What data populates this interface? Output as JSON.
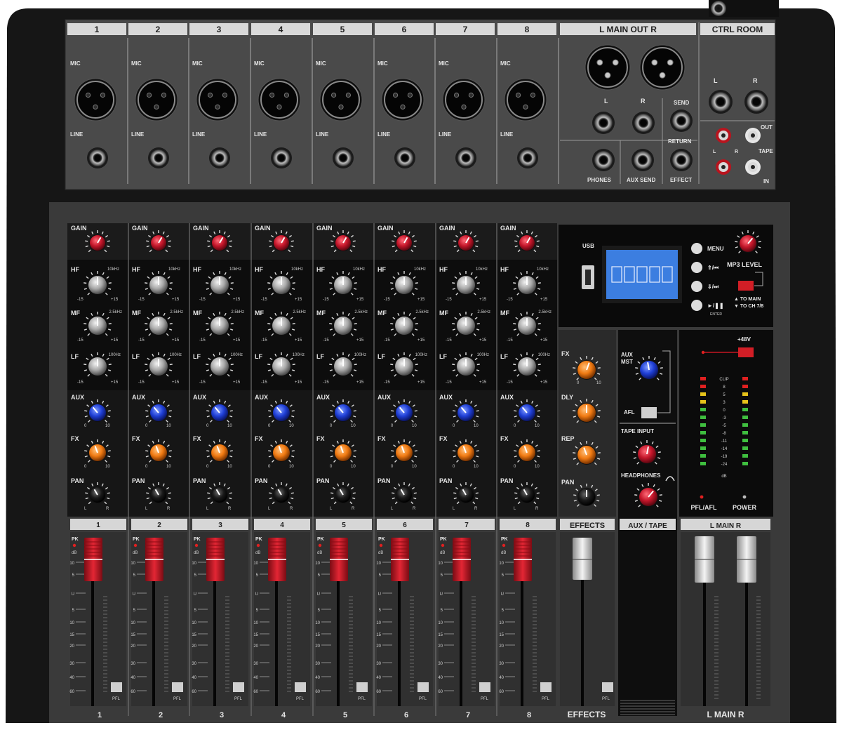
{
  "top_panel": {
    "channel_numbers": [
      "1",
      "2",
      "3",
      "4",
      "5",
      "6",
      "7",
      "8"
    ],
    "main_out_title": "L  MAIN OUT  R",
    "ctrl_room_title": "CTRL ROOM",
    "mic_label": "MIC",
    "line_label": "LINE",
    "main_out_l": "L",
    "main_out_r": "R",
    "send_label": "SEND",
    "return_label": "RETURN",
    "phones_label": "PHONES",
    "aux_send_label": "AUX SEND",
    "effect_label": "EFFECT",
    "ctrl_l": "L",
    "ctrl_r": "R",
    "out_label": "OUT",
    "tape_label": "TAPE",
    "in_label": "IN",
    "tape_l": "L",
    "tape_r": "R"
  },
  "channel_strip": {
    "gain_label": "GAIN",
    "hf_label": "HF",
    "hf_freq": "10kHz",
    "mf_label": "MF",
    "mf_freq": "2.5kHz",
    "lf_label": "LF",
    "lf_freq": "100Hz",
    "eq_min": "-15",
    "eq_max": "+15",
    "aux_label": "AUX",
    "fx_label": "FX",
    "pan_label": "PAN",
    "send_min": "0",
    "send_max": "10",
    "pan_left": "L",
    "pan_right": "R",
    "pk_label": "PK",
    "db_label": "dB",
    "u_label": "U",
    "pfl_label": "PFL",
    "fader_scale": [
      "10",
      "5",
      "U",
      "5",
      "10",
      "15",
      "20",
      "30",
      "40",
      "60"
    ]
  },
  "channels": [
    {
      "number": "1"
    },
    {
      "number": "2"
    },
    {
      "number": "3"
    },
    {
      "number": "4"
    },
    {
      "number": "5"
    },
    {
      "number": "6"
    },
    {
      "number": "7"
    },
    {
      "number": "8"
    }
  ],
  "mp3_player": {
    "usb_label": "USB",
    "menu_label": "MENU",
    "prev_label": "⇑/⏮",
    "next_label": "⇓/⏭",
    "play_label": "►/❚❚",
    "enter_label": "ENTER",
    "mp3_level_label": "MP3 LEVEL",
    "to_main_label": "▲ TO MAIN",
    "to_ch_label": "▼ TO CH 7/8",
    "screen_bg": "#3c7ee0"
  },
  "effects_section": {
    "fx_label": "FX",
    "dly_label": "DLY",
    "rep_label": "REP",
    "pan_label": "PAN",
    "section_title": "EFFECTS",
    "bottom_label": "EFFECTS",
    "pfl_label": "PFL",
    "min": "0",
    "max": "10"
  },
  "aux_tape_section": {
    "aux_mst_label": "AUX MST",
    "afl_label": "AFL",
    "tape_input_label": "TAPE INPUT",
    "headphones_label": "HEADPHONES",
    "section_title": "AUX / TAPE"
  },
  "main_section": {
    "phantom_label": "+48V",
    "meter_scale": [
      "CLIP",
      "8",
      "5",
      "3",
      "0",
      "-3",
      "-5",
      "-8",
      "-11",
      "-14",
      "-19",
      "-24"
    ],
    "db_label": "dB",
    "pfl_afl_label": "PFL/AFL",
    "power_label": "POWER",
    "section_title": "L   MAIN   R",
    "bottom_label": "L   MAIN   R"
  },
  "colors": {
    "panel": "#3b3b3b",
    "panel_dark": "#1f1f1f",
    "gain_knob": "#c4162a",
    "eq_knob": "#a9a9a9",
    "aux_knob": "#1f3fd6",
    "fx_knob": "#f07a12",
    "pan_knob": "#1a1a1a",
    "fader_cap": "#c41622",
    "master_fader": "#d9d9d9",
    "led_green": "#3fbf3f",
    "led_red": "#e02020"
  }
}
